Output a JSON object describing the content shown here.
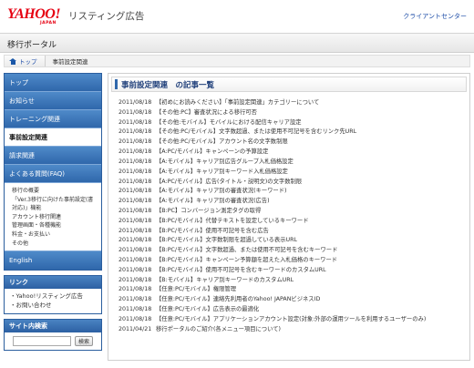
{
  "header": {
    "logo_text": "YAHOO!",
    "logo_sub": "JAPAN",
    "brand": "リスティング広告",
    "client_center": "クライアントセンター"
  },
  "portal": {
    "title": "移行ポータル"
  },
  "breadcrumb": {
    "home": "トップ",
    "current": "事前設定関連"
  },
  "sidebar": {
    "items": [
      {
        "label": "トップ"
      },
      {
        "label": "お知らせ"
      },
      {
        "label": "トレーニング関連"
      },
      {
        "label": "事前設定関連"
      },
      {
        "label": "請求関連"
      },
      {
        "label": "よくある質問(FAQ)"
      }
    ],
    "sub_items": [
      {
        "label": "移行の概要"
      },
      {
        "label": "「Ver.3移行に向けた事前設定(書"
      },
      {
        "label": "対応)」機能"
      },
      {
        "label": "アカウント移行関連"
      },
      {
        "label": "管理画面・各種機能"
      },
      {
        "label": "料金・お支払い"
      },
      {
        "label": "その他"
      }
    ],
    "english": "English"
  },
  "links_box": {
    "title": "リンク",
    "items": [
      {
        "label": "・Yahoo!リスティング広告"
      },
      {
        "label": "・お問い合わせ"
      }
    ]
  },
  "search_box": {
    "title": "サイト内検索",
    "placeholder": "",
    "button": "検索"
  },
  "main": {
    "title": "事前設定関連　の記事一覧",
    "articles": [
      {
        "date": "2011/08/18",
        "title": "【初めにお読みください】「事前設定関連」カテゴリーについて"
      },
      {
        "date": "2011/08/18",
        "title": "【その他:PC】審査状況による移行可否"
      },
      {
        "date": "2011/08/18",
        "title": "【その他:モバイル】モバイルにおける配信キャリア設定"
      },
      {
        "date": "2011/08/18",
        "title": "【その他:PC/モバイル】文字数超過、または使用不可記号を含むリンク先URL"
      },
      {
        "date": "2011/08/18",
        "title": "【その他:PC/モバイル】アカウント名の文字数制限"
      },
      {
        "date": "2011/08/18",
        "title": "【A:PC/モバイル】キャンペーンの予算設定"
      },
      {
        "date": "2011/08/18",
        "title": "【A:モバイル】キャリア別広告グループ入札価格設定"
      },
      {
        "date": "2011/08/18",
        "title": "【A:モバイル】キャリア別キーワード入札価格設定"
      },
      {
        "date": "2011/08/18",
        "title": "【A:PC/モバイル】広告(タイトル・説明文)の文字数制限"
      },
      {
        "date": "2011/08/18",
        "title": "【A:モバイル】キャリア別の審査状況(キーワード)"
      },
      {
        "date": "2011/08/18",
        "title": "【A:モバイル】キャリア別の審査状況(広告)"
      },
      {
        "date": "2011/08/18",
        "title": "【B:PC】コンバージョン測定タグの取得"
      },
      {
        "date": "2011/08/18",
        "title": "【B:PC/モバイル】代替テキストを設定しているキーワード"
      },
      {
        "date": "2011/08/18",
        "title": "【B:PC/モバイル】使用不可記号を含む広告"
      },
      {
        "date": "2011/08/18",
        "title": "【B:PC/モバイル】文字数制限を超過している表示URL"
      },
      {
        "date": "2011/08/18",
        "title": "【B:PC/モバイル】文字数超過、または使用不可記号を含むキーワード"
      },
      {
        "date": "2011/08/18",
        "title": "【B:PC/モバイル】キャンペーン予算額を超えた入札価格のキーワード"
      },
      {
        "date": "2011/08/18",
        "title": "【B:PC/モバイル】使用不可記号を含むキーワードのカスタムURL"
      },
      {
        "date": "2011/08/18",
        "title": "【B:モバイル】キャリア別キーワードのカスタムURL"
      },
      {
        "date": "2011/08/18",
        "title": "【任意:PC/モバイル】権限管理"
      },
      {
        "date": "2011/08/18",
        "title": "【任意:PC/モバイル】連絡先利用者のYahoo! JAPANビジネスID"
      },
      {
        "date": "2011/08/18",
        "title": "【任意:PC/モバイル】広告表示の最適化"
      },
      {
        "date": "2011/08/18",
        "title": "【任意:PC/モバイル】アプリケーションアカウント設定(対象:外部の運用ツールを利用するユーザーのみ)"
      },
      {
        "date": "2011/04/21",
        "title": "移行ポータルのご紹介(各メニュー項目について)"
      }
    ]
  },
  "colors": {
    "nav_blue": "#2f67ab",
    "logo_red": "#e60012",
    "link_blue": "#1a4aa6"
  }
}
